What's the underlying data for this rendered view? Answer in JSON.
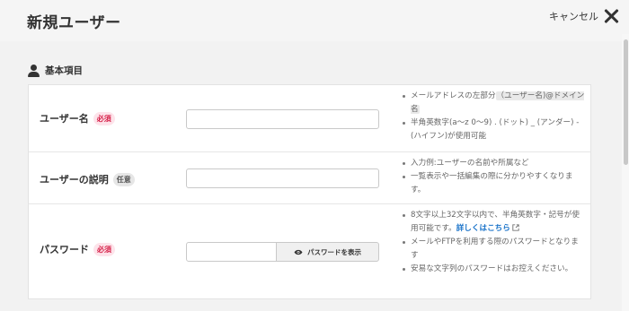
{
  "header": {
    "title": "新規ユーザー",
    "cancel_label": "キャンセル"
  },
  "section": {
    "title": "基本項目"
  },
  "fields": [
    {
      "label": "ユーザー名",
      "badge": "必須",
      "value": "",
      "help": [
        {
          "pre": "メールアドレスの左部分",
          "hl": "（ユーザー名)@ドメイン名",
          "post": ""
        },
        {
          "pre": "半角英数字(a〜z 0〜9) . (ドット) _ (アンダー) - (ハイフン)が使用可能",
          "hl": "",
          "post": ""
        }
      ]
    },
    {
      "label": "ユーザーの説明",
      "badge": "任意",
      "value": "",
      "help": [
        {
          "pre": "入力例:ユーザーの名前や所属など"
        },
        {
          "pre": "一覧表示や一括編集の際に分かりやすくなります。"
        }
      ]
    },
    {
      "label": "パスワード",
      "badge": "必須",
      "value": "",
      "show_password_label": "パスワードを表示",
      "help": [
        {
          "pre": "8文字以上32文字以内で、半角英数字・記号が使用可能です。",
          "link": "詳しくはこちら"
        },
        {
          "pre": "メールやFTPを利用する際のパスワードとなります"
        },
        {
          "pre": "安易な文字列のパスワードはお控えください。"
        }
      ]
    }
  ],
  "icons": {
    "cancel": "close-icon",
    "section": "person-icon",
    "show_password": "eye-icon",
    "external_link": "external-link-icon"
  },
  "colors": {
    "required_badge_text": "#d6224a",
    "required_badge_bg": "#fde3ea",
    "optional_badge_bg": "#e6e6e6",
    "link": "#1a73c9"
  }
}
